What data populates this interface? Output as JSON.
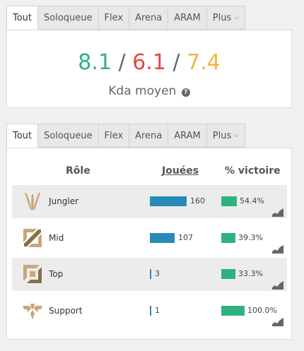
{
  "tabs_top": [
    "Tout",
    "Soloqueue",
    "Flex",
    "Arena",
    "ARAM",
    "Plus"
  ],
  "tabs_bottom": [
    "Tout",
    "Soloqueue",
    "Flex",
    "Arena",
    "ARAM",
    "Plus"
  ],
  "kda": {
    "kills": "8.1",
    "deaths": "6.1",
    "assists": "7.4",
    "separator": "/",
    "label": "Kda moyen",
    "help_glyph": "?"
  },
  "roles_table": {
    "headers": {
      "role": "Rôle",
      "games": "Jouées",
      "winrate": "% victoire"
    },
    "max_games": 160,
    "rows": [
      {
        "role": "Jungler",
        "icon": "jungler-icon",
        "games": 160,
        "games_label": "160",
        "winrate": 54.4,
        "winrate_label": "54.4%"
      },
      {
        "role": "Mid",
        "icon": "mid-icon",
        "games": 107,
        "games_label": "107",
        "winrate": 39.3,
        "winrate_label": "39.3%"
      },
      {
        "role": "Top",
        "icon": "top-icon",
        "games": 3,
        "games_label": "3",
        "winrate": 33.3,
        "winrate_label": "33.3%"
      },
      {
        "role": "Support",
        "icon": "support-icon",
        "games": 1,
        "games_label": "1",
        "winrate": 100.0,
        "winrate_label": "100.0%"
      }
    ]
  },
  "colors": {
    "kills": "#2fb27f",
    "deaths": "#e4463e",
    "assists": "#f2b544",
    "games_bar": "#2a8ab8",
    "winrate_bar": "#2fb27f",
    "role_icon_gold": "#c9a77a"
  }
}
